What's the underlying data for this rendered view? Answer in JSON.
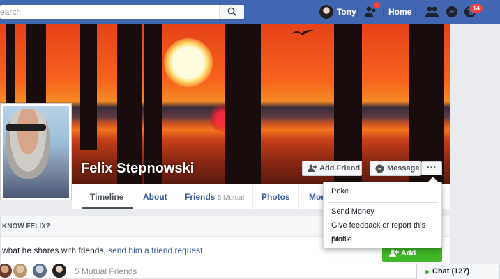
{
  "search": {
    "placeholder": "Search",
    "value": "earch"
  },
  "nav": {
    "user_name": "Tony",
    "home": "Home",
    "notifications_count": "14"
  },
  "cover": {
    "name": "Felix Stepnowski"
  },
  "actions": {
    "add_friend": "Add Friend",
    "message": "Message",
    "more": "···"
  },
  "tabs": [
    {
      "label": "Timeline"
    },
    {
      "label": "About"
    },
    {
      "label": "Friends",
      "sub": "5 Mutual"
    },
    {
      "label": "Photos"
    },
    {
      "label": "Mor"
    }
  ],
  "menu": {
    "items": [
      "Poke",
      "Send Money",
      "Give feedback or report this profile",
      "Block"
    ]
  },
  "card": {
    "heading": "KNOW FELIX?",
    "text_before": "what he shares with friends, ",
    "link": "send him a friend request.",
    "mutual": "5 Mutual Friends",
    "add_friend": "Add Friend"
  },
  "chat": {
    "label": "Chat (127)"
  },
  "colors": {
    "brand": "#4267b2",
    "green": "#42b72a",
    "badge": "#fa3e3e"
  }
}
